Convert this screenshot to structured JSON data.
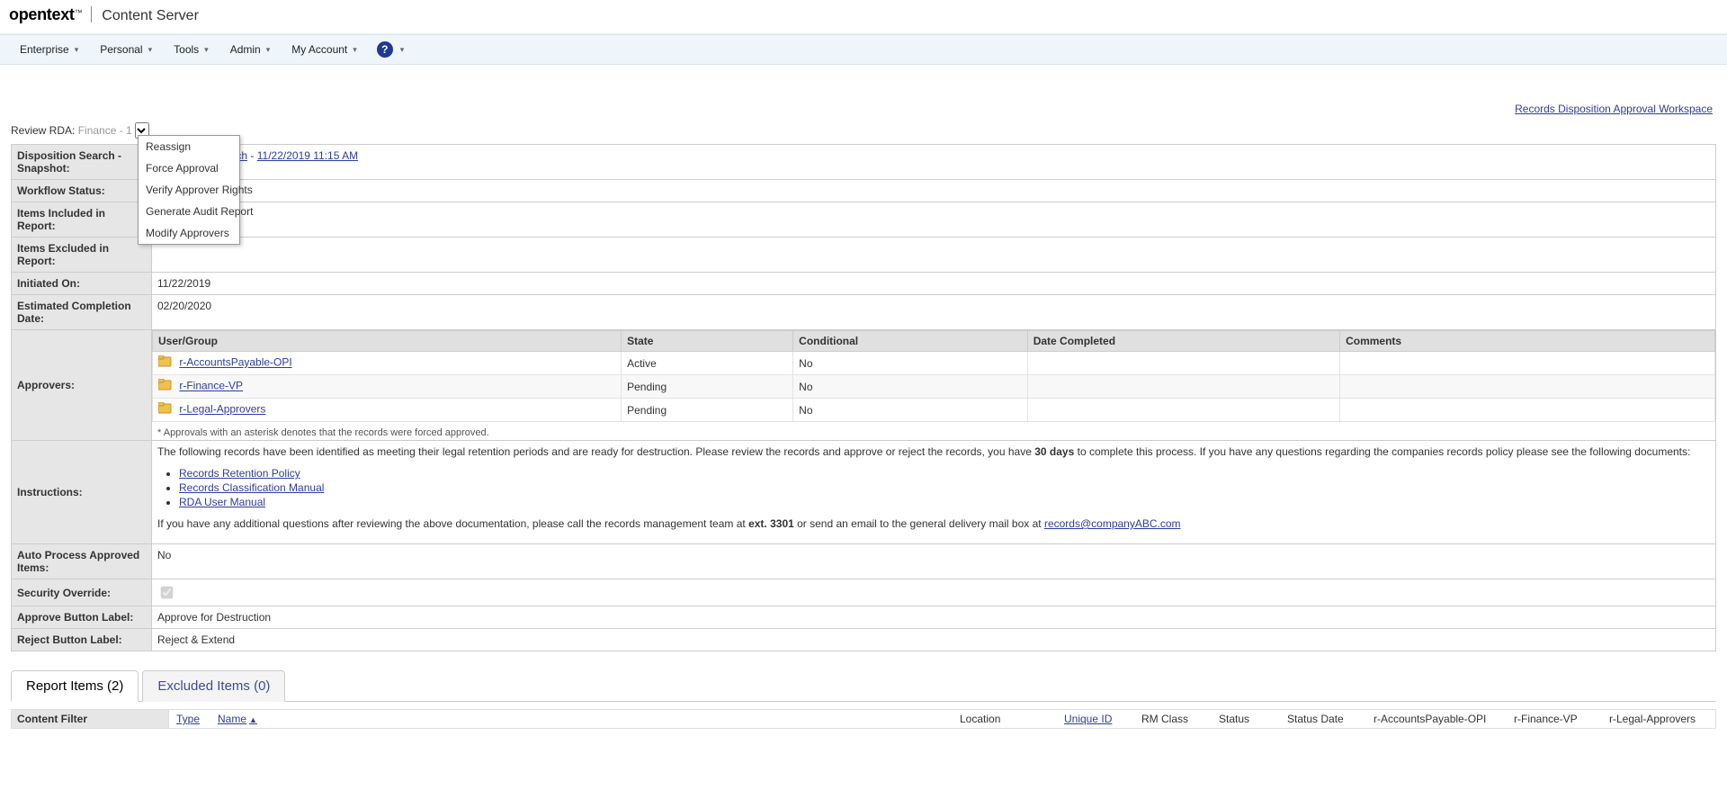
{
  "brand": {
    "name": "opentext",
    "suffix": "™",
    "product": "Content Server"
  },
  "menu": {
    "items": [
      "Enterprise",
      "Personal",
      "Tools",
      "Admin",
      "My Account"
    ]
  },
  "top_link": "Records Disposition Approval Workspace",
  "review": {
    "label": "Review RDA:",
    "select_value": "Finance - 1"
  },
  "action_menu": [
    "Reassign",
    "Force Approval",
    "Verify Approver Rights",
    "Generate Audit Report",
    "Modify Approvers"
  ],
  "details": {
    "disposition_search_label": "Disposition Search - Snapshot:",
    "disposition_search_link_text": "n Search",
    "disposition_search_date": "11/22/2019 11:15 AM",
    "workflow_status_label": "Workflow Status:",
    "workflow_status_value": "",
    "items_included_label": "Items Included in Report:",
    "items_included_value": "",
    "items_excluded_label": "Items Excluded in Report:",
    "items_excluded_value": "",
    "initiated_on_label": "Initiated On:",
    "initiated_on_value": "11/22/2019",
    "est_completion_label": "Estimated Completion Date:",
    "est_completion_value": "02/20/2020",
    "approvers_label": "Approvers:",
    "approvers_columns": [
      "User/Group",
      "State",
      "Conditional",
      "Date Completed",
      "Comments"
    ],
    "approvers_rows": [
      {
        "name": "r-AccountsPayable-OPI",
        "state": "Active",
        "conditional": "No",
        "date_completed": "",
        "comments": ""
      },
      {
        "name": "r-Finance-VP",
        "state": "Pending",
        "conditional": "No",
        "date_completed": "",
        "comments": ""
      },
      {
        "name": "r-Legal-Approvers",
        "state": "Pending",
        "conditional": "No",
        "date_completed": "",
        "comments": ""
      }
    ],
    "approvers_footnote": "* Approvals with an asterisk denotes that the records were forced approved.",
    "instructions_label": "Instructions:",
    "instructions": {
      "para1_a": "The following records have been identified as meeting their legal retention periods and are ready for destruction. Please review the records and approve or reject the records, you have ",
      "para1_bold": "30 days",
      "para1_b": " to complete this process. If you have any questions regarding the companies records policy please see the following documents:",
      "links": [
        "Records Retention Policy",
        "Records Classification Manual",
        "RDA User Manual"
      ],
      "para2_a": "If you have any additional questions after reviewing the above documentation, please call the records management team at ",
      "para2_bold": "ext. 3301",
      "para2_b": " or send an email to the general delivery mail box at ",
      "email": "records@companyABC.com"
    },
    "auto_process_label": "Auto Process Approved Items:",
    "auto_process_value": "No",
    "security_override_label": "Security Override:",
    "approve_btn_label_label": "Approve Button Label:",
    "approve_btn_label_value": "Approve for Destruction",
    "reject_btn_label_label": "Reject Button Label:",
    "reject_btn_label_value": "Reject & Extend"
  },
  "tabs": {
    "report_items": "Report Items (2)",
    "excluded_items": "Excluded Items (0)"
  },
  "filter": {
    "label": "Content Filter",
    "cols": {
      "type": "Type",
      "name": "Name",
      "location": "Location",
      "unique_id": "Unique ID",
      "rm_class": "RM Class",
      "status": "Status",
      "status_date": "Status Date",
      "appr1": "r-AccountsPayable-OPI",
      "appr2": "r-Finance-VP",
      "appr3": "r-Legal-Approvers"
    }
  }
}
